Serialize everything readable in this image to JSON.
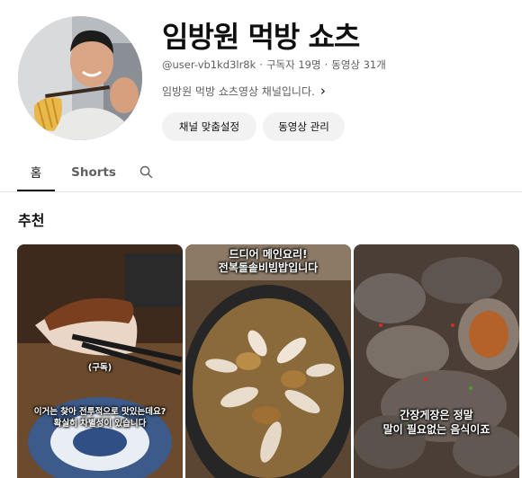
{
  "channel": {
    "title": "임방원 먹방 쇼츠",
    "handle": "@user-vb1kd3lr8k",
    "subscribers": "구독자 19명",
    "video_count": "동영상 31개",
    "description": "임방원 먹방 쇼츠영상 채널입니다.",
    "avatar_icon": "person-eating-noodles"
  },
  "buttons": {
    "customize": "채널 맞춤설정",
    "manage": "동영상 관리"
  },
  "tabs": {
    "home": "홈",
    "shorts": "Shorts",
    "search_icon": "search-icon"
  },
  "section": {
    "title": "추천"
  },
  "shorts": [
    {
      "caption_top": "(구독)",
      "caption_line1": "이거는 찾아 전투적으로 맛있는데요?",
      "caption_line2": "확실히 차별성이 있습니다"
    },
    {
      "caption_line1": "드디어 메인요리!",
      "caption_line2": "전복돌솥비빔밥입니다"
    },
    {
      "caption_line1": "간장게장은 정말",
      "caption_line2": "말이 필요없는 음식이죠"
    }
  ],
  "colors": {
    "text_primary": "#0f0f0f",
    "text_secondary": "#606060",
    "button_bg": "#f2f2f2",
    "divider": "#e5e5e5"
  }
}
